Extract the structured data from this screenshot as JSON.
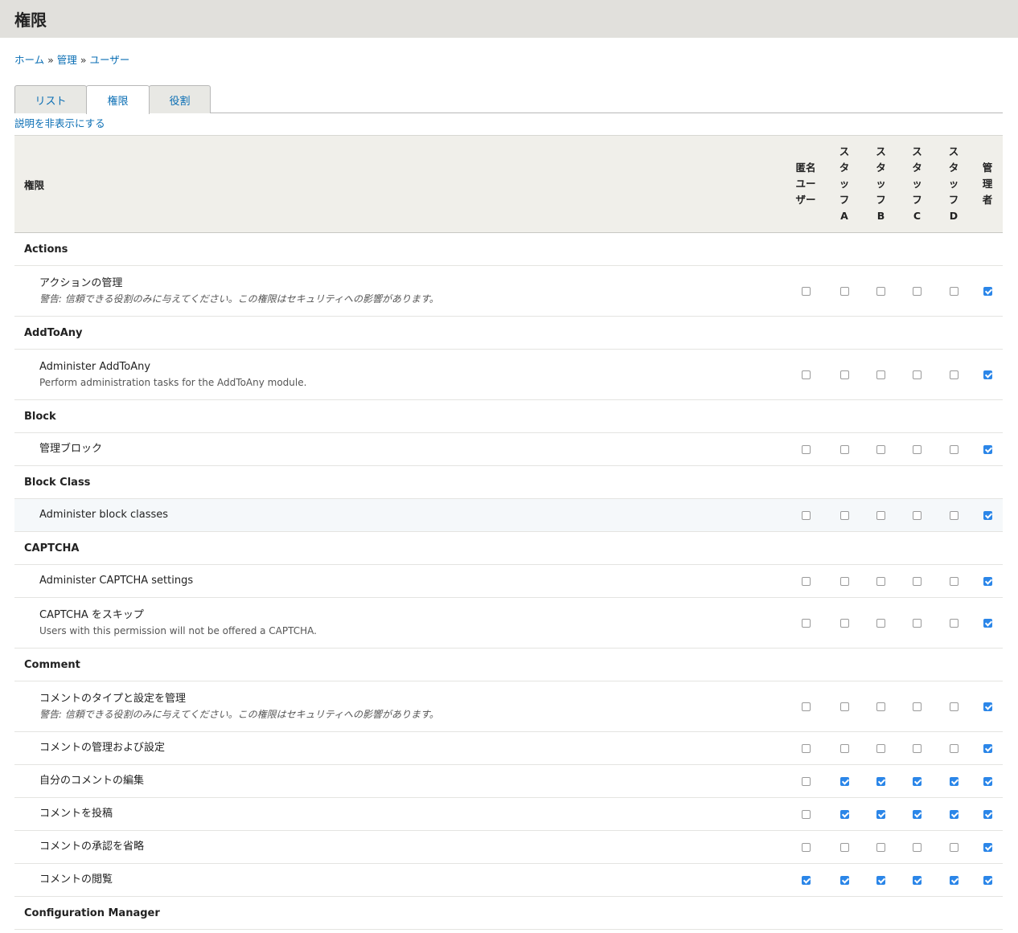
{
  "page": {
    "title": "権限"
  },
  "breadcrumb": {
    "items": [
      "ホーム",
      "管理",
      "ユーザー"
    ],
    "separator": "»"
  },
  "tabs": [
    {
      "label": "リスト",
      "active": false
    },
    {
      "label": "権限",
      "active": true
    },
    {
      "label": "役割",
      "active": false
    }
  ],
  "hide_descriptions": "説明を非表示にする",
  "table": {
    "permission_header": "権限",
    "roles": [
      "匿名ユーザー",
      "スタッフA",
      "スタッフB",
      "スタッフC",
      "スタッフD",
      "管理者"
    ],
    "modules": [
      {
        "name": "Actions",
        "permissions": [
          {
            "name": "アクションの管理",
            "warning": "警告: 信頼できる役割のみに与えてください。この権限はセキュリティへの影響があります。",
            "checks": [
              false,
              false,
              false,
              false,
              false,
              true
            ]
          }
        ]
      },
      {
        "name": "AddToAny",
        "permissions": [
          {
            "name": "Administer AddToAny",
            "desc": "Perform administration tasks for the AddToAny module.",
            "checks": [
              false,
              false,
              false,
              false,
              false,
              true
            ]
          }
        ]
      },
      {
        "name": "Block",
        "permissions": [
          {
            "name": "管理ブロック",
            "checks": [
              false,
              false,
              false,
              false,
              false,
              true
            ]
          }
        ]
      },
      {
        "name": "Block Class",
        "permissions": [
          {
            "name": "Administer block classes",
            "checks": [
              false,
              false,
              false,
              false,
              false,
              true
            ],
            "highlight": true
          }
        ]
      },
      {
        "name": "CAPTCHA",
        "permissions": [
          {
            "name": "Administer CAPTCHA settings",
            "checks": [
              false,
              false,
              false,
              false,
              false,
              true
            ]
          },
          {
            "name": "CAPTCHA をスキップ",
            "desc": "Users with this permission will not be offered a CAPTCHA.",
            "checks": [
              false,
              false,
              false,
              false,
              false,
              true
            ]
          }
        ]
      },
      {
        "name": "Comment",
        "permissions": [
          {
            "name": "コメントのタイプと設定を管理",
            "warning": "警告: 信頼できる役割のみに与えてください。この権限はセキュリティへの影響があります。",
            "checks": [
              false,
              false,
              false,
              false,
              false,
              true
            ]
          },
          {
            "name": "コメントの管理および設定",
            "checks": [
              false,
              false,
              false,
              false,
              false,
              true
            ]
          },
          {
            "name": "自分のコメントの編集",
            "checks": [
              false,
              true,
              true,
              true,
              true,
              true
            ]
          },
          {
            "name": "コメントを投稿",
            "checks": [
              false,
              true,
              true,
              true,
              true,
              true
            ]
          },
          {
            "name": "コメントの承認を省略",
            "checks": [
              false,
              false,
              false,
              false,
              false,
              true
            ]
          },
          {
            "name": "コメントの閲覧",
            "checks": [
              true,
              true,
              true,
              true,
              true,
              true
            ]
          }
        ]
      },
      {
        "name": "Configuration Manager",
        "permissions": []
      }
    ]
  },
  "colors": {
    "link": "#0a6eb4",
    "header_bg": "#e1e0dc",
    "checkbox_on": "#2b86e8"
  }
}
